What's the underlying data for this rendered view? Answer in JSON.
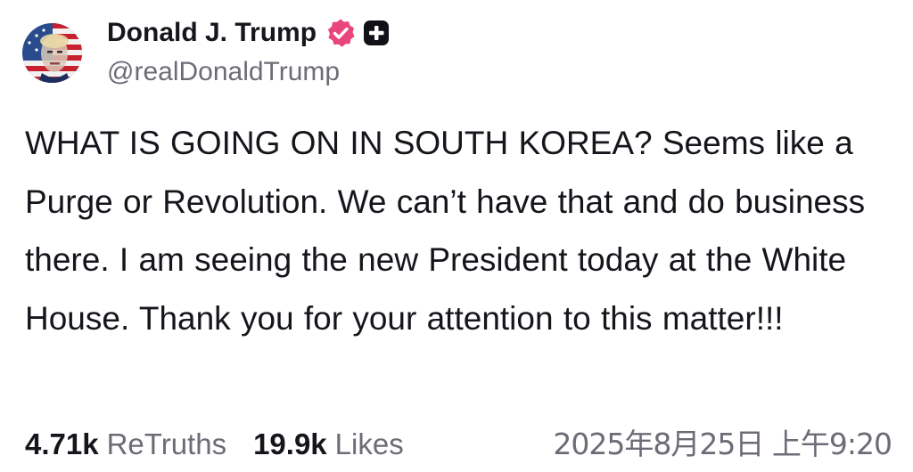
{
  "author": {
    "display_name": "Donald J. Trump",
    "handle": "@realDonaldTrump",
    "avatar_icon": "avatar-flag-portrait-icon",
    "verified_icon": "verified-badge-icon",
    "verified_color": "#e8467c",
    "plus_icon": "truth-plus-icon"
  },
  "post": {
    "text": "WHAT IS GOING ON IN SOUTH KOREA? Seems like a Purge or Revolution. We can’t have that and do business there. I am seeing the new President today at the White House. Thank you for your attention to this matter!!!"
  },
  "stats": {
    "retruths_count": "4.71k",
    "retruths_label": "ReTruths",
    "likes_count": "19.9k",
    "likes_label": "Likes",
    "timestamp": "2025年8月25日 上午9:20"
  }
}
